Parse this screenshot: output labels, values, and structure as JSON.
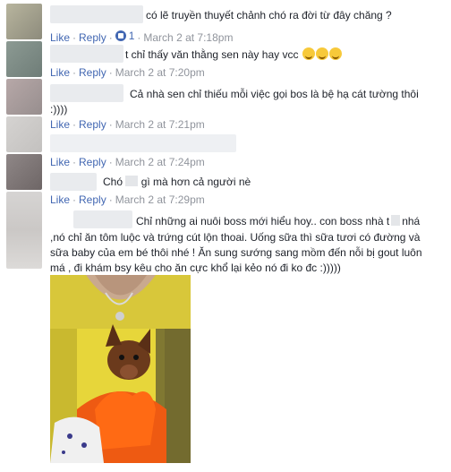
{
  "comments": [
    {
      "text": "có lẽ truyền thuyết chảnh chó ra đời từ đây chăng ?",
      "like": "Like",
      "reply": "Reply",
      "like_count": "1",
      "time": "March 2 at 7:18pm"
    },
    {
      "text": "t chỉ thấy văn thằng sen này hay vcc",
      "like": "Like",
      "reply": "Reply",
      "time": "March 2 at 7:20pm",
      "emojis": [
        "grinning-emoji",
        "grinning-emoji",
        "grinning-emoji"
      ]
    },
    {
      "text": "Cả nhà sen chỉ thiếu mỗi việc gọi bos là bệ hạ cát tường thôi",
      "text_line2": ":))))",
      "like": "Like",
      "reply": "Reply",
      "time": "March 2 at 7:21pm"
    },
    {
      "like": "Like",
      "reply": "Reply",
      "time": "March 2 at 7:24pm"
    },
    {
      "text_a": "Chó",
      "text_b": "gì mà hơn cả người nè",
      "like": "Like",
      "reply": "Reply",
      "time": "March 2 at 7:29pm"
    },
    {
      "line1": "Chỉ những ai nuôi boss mới hiểu hoy.. con boss nhà t",
      "line1_end": "nhá",
      "line2": ",nó chỉ ăn tôm luộc và trứng cút lộn thoai. Uống sữa thì sữa tươi có đường và",
      "line3": "sữa baby của em bé thôi nhé ! Ăn sung sướng sang mồm đến nỗi bị gout luôn",
      "line4": "má , đi khám bsy kêu cho ăn cực khổ lại kẻo nó đi ko đc :)))))"
    }
  ],
  "colors": {
    "link": "#4267b2",
    "meta": "#90949c",
    "text": "#1d2129"
  }
}
